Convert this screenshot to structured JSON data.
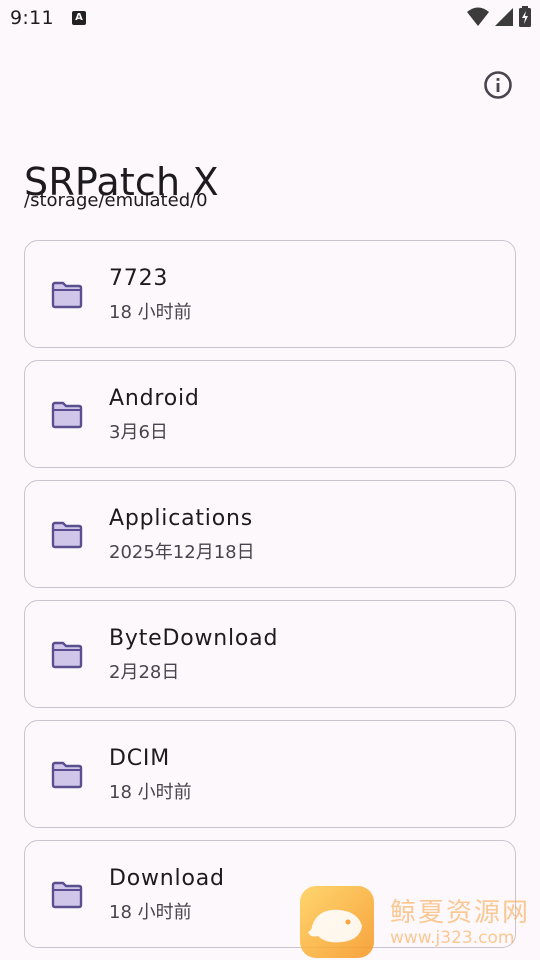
{
  "status_bar": {
    "time": "9:11",
    "notification_icon": "A"
  },
  "header": {
    "title": "SRPatch X",
    "path": "/storage/emulated/0",
    "info_icon": "info-icon"
  },
  "files": [
    {
      "name": "7723",
      "date": "18 小时前",
      "icon": "folder-icon"
    },
    {
      "name": "Android",
      "date": "3月6日",
      "icon": "folder-icon"
    },
    {
      "name": "Applications",
      "date": "2025年12月18日",
      "icon": "folder-icon"
    },
    {
      "name": "ByteDownload",
      "date": "2月28日",
      "icon": "folder-icon"
    },
    {
      "name": "DCIM",
      "date": "18 小时前",
      "icon": "folder-icon"
    },
    {
      "name": "Download",
      "date": "18 小时前",
      "icon": "folder-icon"
    }
  ],
  "watermark": {
    "text": "鲸夏资源网",
    "url": "www.j323.com"
  },
  "colors": {
    "background": "#fdf8fc",
    "card_border": "#cac4cf",
    "folder_fill": "#d0c6ea",
    "folder_stroke": "#5b4f8f",
    "text_primary": "#1d1b20",
    "text_secondary": "#49454f"
  }
}
